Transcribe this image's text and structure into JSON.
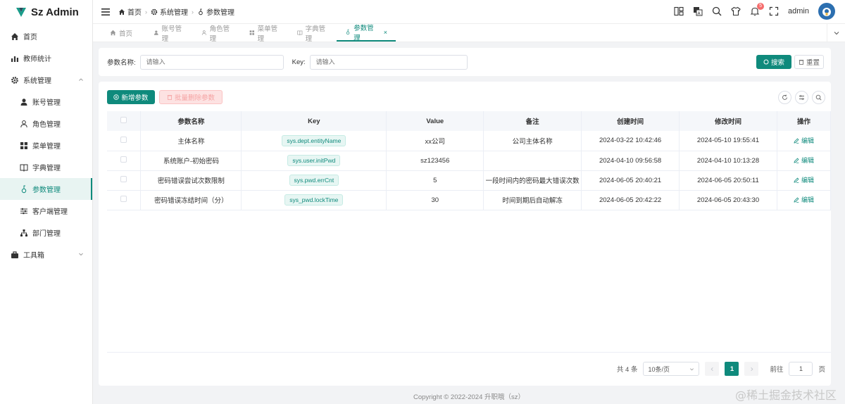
{
  "app": {
    "title": "Sz Admin"
  },
  "sidebar": {
    "items": [
      {
        "label": "首页",
        "icon": "home-icon",
        "level": 1
      },
      {
        "label": "教师统计",
        "icon": "chart-icon",
        "level": 1
      },
      {
        "label": "系统管理",
        "icon": "gear-icon",
        "level": 1,
        "expanded": true
      },
      {
        "label": "账号管理",
        "icon": "user-icon",
        "level": 2
      },
      {
        "label": "角色管理",
        "icon": "user-outline-icon",
        "level": 2
      },
      {
        "label": "菜单管理",
        "icon": "grid-icon",
        "level": 2
      },
      {
        "label": "字典管理",
        "icon": "book-icon",
        "level": 2
      },
      {
        "label": "参数管理",
        "icon": "param-icon",
        "level": 2,
        "active": true
      },
      {
        "label": "客户端管理",
        "icon": "sliders-icon",
        "level": 2
      },
      {
        "label": "部门管理",
        "icon": "org-icon",
        "level": 2
      },
      {
        "label": "工具箱",
        "icon": "toolbox-icon",
        "level": 1,
        "expanded": false
      }
    ]
  },
  "breadcrumb": [
    "首页",
    "系统管理",
    "参数管理"
  ],
  "header": {
    "user": "admin",
    "notification_count": "5"
  },
  "tabs": [
    {
      "label": "首页",
      "icon": "home-icon"
    },
    {
      "label": "账号管理",
      "icon": "user-icon"
    },
    {
      "label": "角色管理",
      "icon": "user-outline-icon"
    },
    {
      "label": "菜单管理",
      "icon": "grid-icon"
    },
    {
      "label": "字典管理",
      "icon": "book-icon"
    },
    {
      "label": "参数管理",
      "icon": "param-icon",
      "active": true
    }
  ],
  "search": {
    "name_label": "参数名称:",
    "name_placeholder": "请输入",
    "key_label": "Key:",
    "key_placeholder": "请输入",
    "search_btn": "搜索",
    "reset_btn": "重置"
  },
  "toolbar": {
    "add_btn": "新增参数",
    "batch_delete_btn": "批量删除参数"
  },
  "table": {
    "columns": [
      "参数名称",
      "Key",
      "Value",
      "备注",
      "创建时间",
      "修改时间",
      "操作"
    ],
    "rows": [
      {
        "name": "主体名称",
        "key": "sys.dept.entityName",
        "value": "xx公司",
        "remark": "公司主体名称",
        "created": "2024-03-22 10:42:46",
        "updated": "2024-05-10 19:55:41",
        "action": "编辑"
      },
      {
        "name": "系统账户-初始密码",
        "key": "sys.user.initPwd",
        "value": "sz123456",
        "remark": "",
        "created": "2024-04-10 09:56:58",
        "updated": "2024-04-10 10:13:28",
        "action": "编辑"
      },
      {
        "name": "密码错误尝试次数限制",
        "key": "sys.pwd.errCnt",
        "value": "5",
        "remark": "一段时间内的密码最大错误次数",
        "created": "2024-06-05 20:40:21",
        "updated": "2024-06-05 20:50:11",
        "action": "编辑"
      },
      {
        "name": "密码错误冻结时间（分）",
        "key": "sys_pwd.lockTime",
        "value": "30",
        "remark": "时间到期后自动解冻",
        "created": "2024-06-05 20:42:22",
        "updated": "2024-06-05 20:43:30",
        "action": "编辑"
      }
    ]
  },
  "pagination": {
    "total": "共 4 条",
    "page_size": "10条/页",
    "current": "1",
    "goto_label": "前往",
    "goto_value": "1",
    "page_suffix": "页"
  },
  "footer": "Copyright © 2022-2024 升职哦（sz）",
  "watermark": "@稀土掘金技术社区",
  "colors": {
    "primary": "#0f8a7c",
    "danger_light": "#fde2e2",
    "badge": "#f56c6c"
  }
}
